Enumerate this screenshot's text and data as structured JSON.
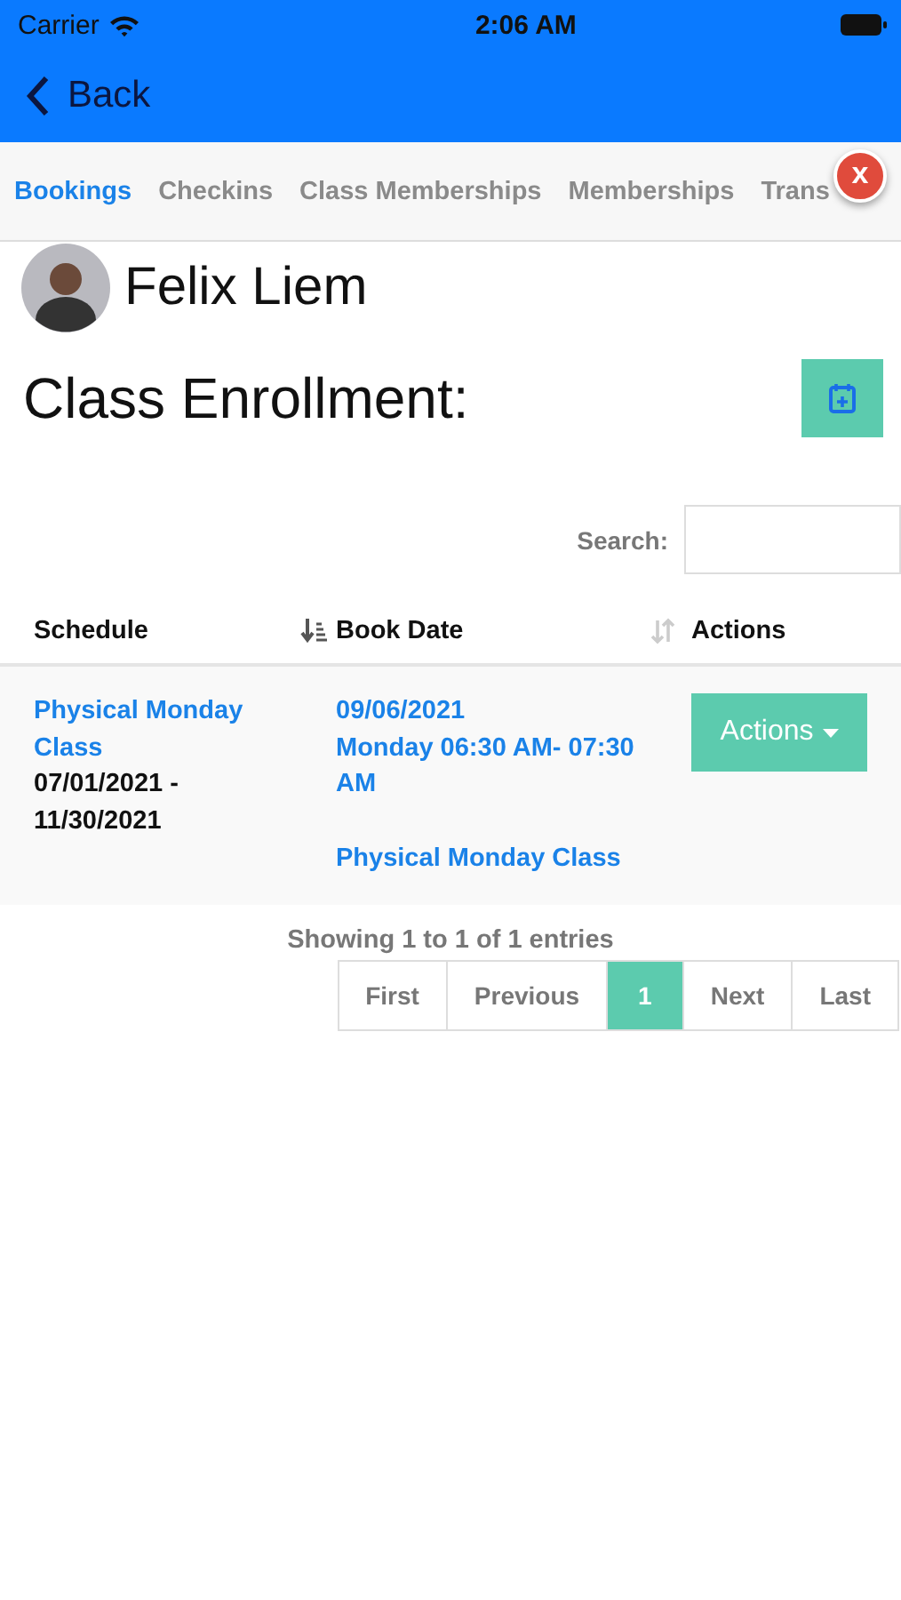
{
  "status_bar": {
    "carrier": "Carrier",
    "time": "2:06 AM"
  },
  "nav": {
    "back_label": "Back"
  },
  "tabs": [
    {
      "label": "Bookings",
      "selected": true
    },
    {
      "label": "Checkins",
      "selected": false
    },
    {
      "label": "Class Memberships",
      "selected": false
    },
    {
      "label": "Memberships",
      "selected": false
    },
    {
      "label": "Trans",
      "selected": false
    }
  ],
  "close_badge": {
    "label": "x"
  },
  "profile": {
    "name": "Felix Liem"
  },
  "section": {
    "title": "Class Enrollment:"
  },
  "search": {
    "label": "Search:"
  },
  "table": {
    "columns": [
      {
        "label": "Schedule",
        "sorted": true
      },
      {
        "label": "Book Date",
        "sorted": false
      },
      {
        "label": "Actions"
      }
    ],
    "rows": [
      {
        "schedule_link": "Physical Monday Class",
        "schedule_range": "07/01/2021 - 11/30/2021",
        "book_date": "09/06/2021",
        "book_time": "Monday 06:30 AM- 07:30 AM",
        "class_link": "Physical Monday Class",
        "action": "Actions"
      }
    ]
  },
  "info": "Showing 1 to 1 of 1 entries",
  "pagination": [
    {
      "label": "First",
      "selected": false
    },
    {
      "label": "Previous",
      "selected": false
    },
    {
      "label": "1",
      "selected": true
    },
    {
      "label": "Next",
      "selected": false
    },
    {
      "label": "Last",
      "selected": false
    }
  ]
}
